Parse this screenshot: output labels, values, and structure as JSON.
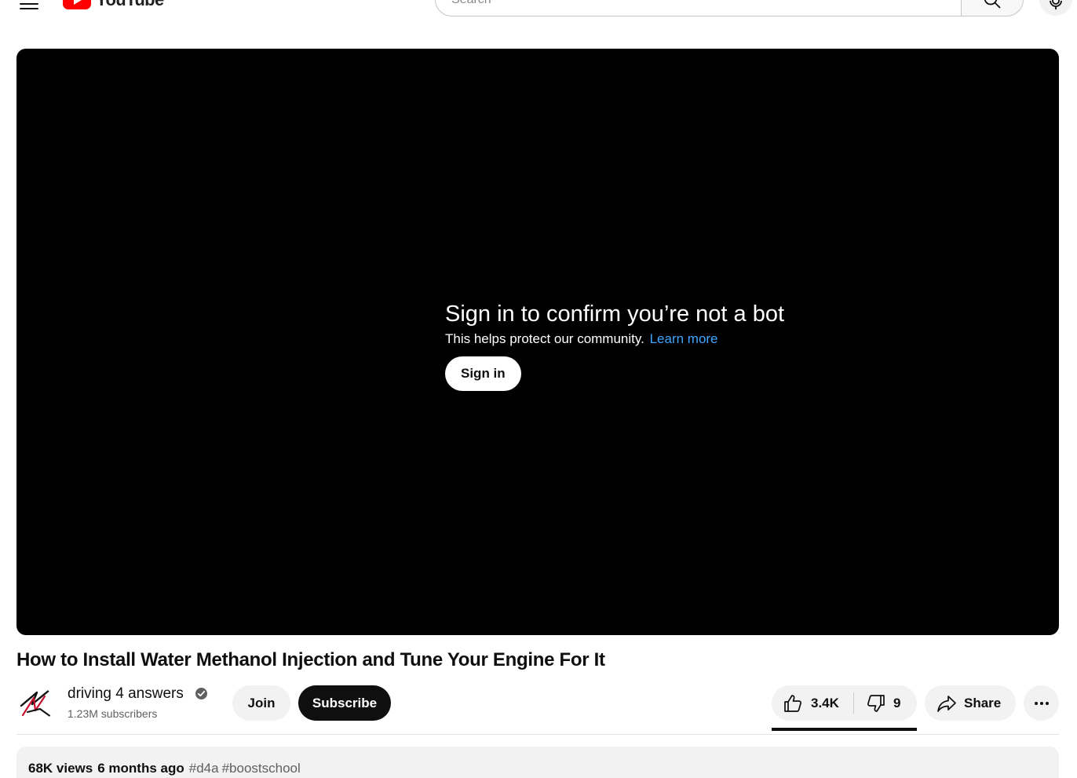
{
  "masthead": {
    "logo_text": "YouTube",
    "search_placeholder": "Search"
  },
  "player": {
    "bot_title": "Sign in to confirm you’re not a bot",
    "bot_subtitle": "This helps protect our community.",
    "learn_more": "Learn more",
    "sign_in_label": "Sign in"
  },
  "video": {
    "title": "How to Install Water Methanol Injection and Tune Your Engine For It"
  },
  "owner": {
    "channel_name": "driving 4 answers",
    "subscribers": "1.23M subscribers",
    "join_label": "Join",
    "subscribe_label": "Subscribe"
  },
  "actions": {
    "likes": "3.4K",
    "dislikes": "9",
    "share_label": "Share"
  },
  "description": {
    "views": "68K views",
    "date": "6 months ago",
    "tags": [
      "#d4a",
      "#boostschool"
    ]
  },
  "colors": {
    "link_blue": "#3ea6ff",
    "brand_red": "#ff0000",
    "subscribe_bg": "#0f0f0f"
  }
}
